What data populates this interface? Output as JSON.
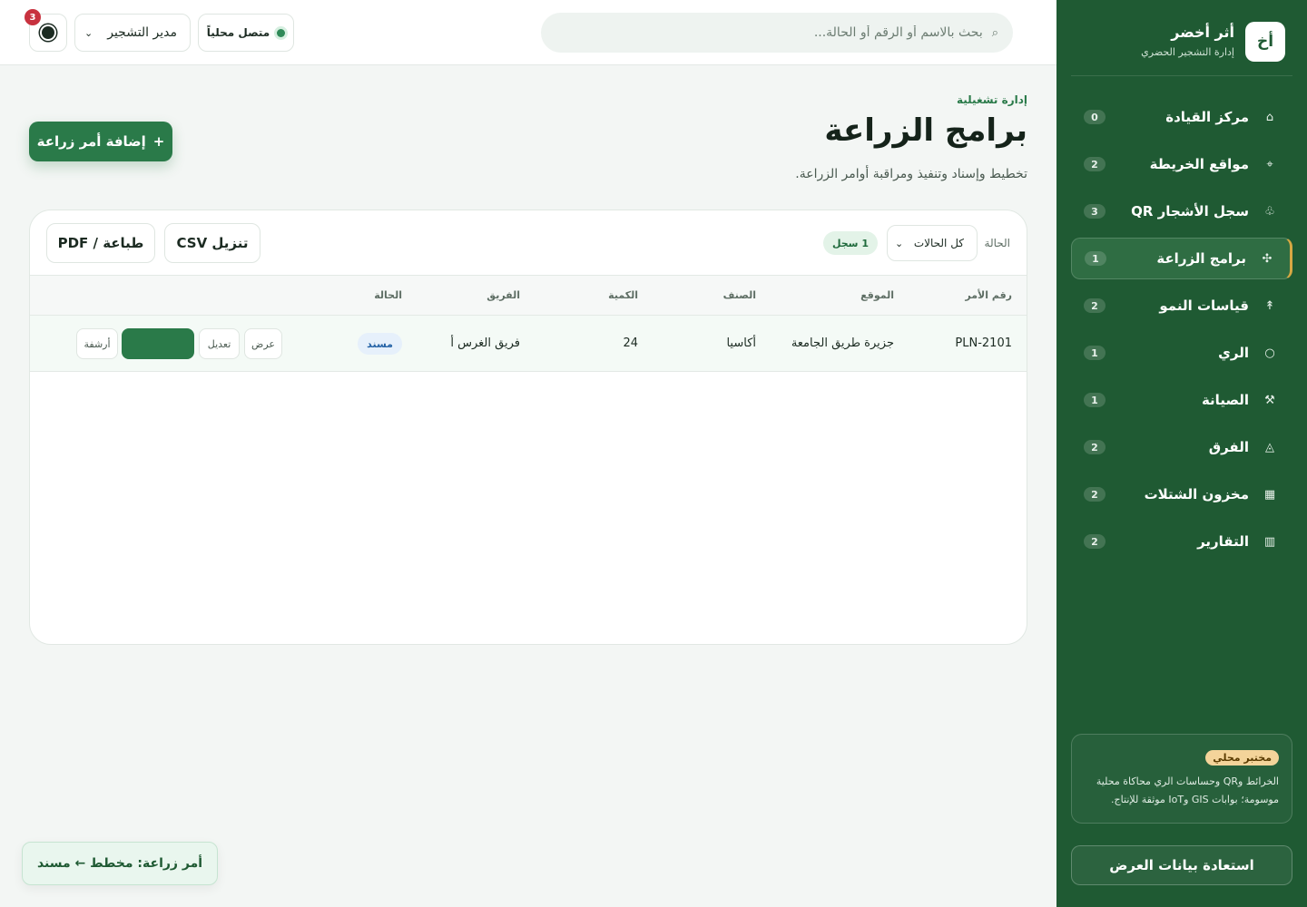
{
  "brand": {
    "logo": "أخ",
    "name": "أثر أخضر",
    "subtitle": "إدارة التشجير الحضري"
  },
  "sidebar": {
    "items": [
      {
        "icon": "⌂",
        "icon_name": "home-icon",
        "label": "مركز القيادة",
        "count": "0"
      },
      {
        "icon": "⌖",
        "icon_name": "map-pin-icon",
        "label": "مواقع الخريطة",
        "count": "2"
      },
      {
        "icon": "♧",
        "icon_name": "tree-icon",
        "label": "سجل الأشجار QR",
        "count": "3"
      },
      {
        "icon": "✣",
        "icon_name": "planting-icon",
        "label": "برامج الزراعة",
        "count": "1"
      },
      {
        "icon": "↟",
        "icon_name": "growth-icon",
        "label": "قياسات النمو",
        "count": "2"
      },
      {
        "icon": "○",
        "icon_name": "water-drop-icon",
        "label": "الري",
        "count": "1"
      },
      {
        "icon": "⚒",
        "icon_name": "tools-icon",
        "label": "الصيانة",
        "count": "1"
      },
      {
        "icon": "◬",
        "icon_name": "team-icon",
        "label": "الفرق",
        "count": "2"
      },
      {
        "icon": "▦",
        "icon_name": "inventory-icon",
        "label": "مخزون الشتلات",
        "count": "2"
      },
      {
        "icon": "▥",
        "icon_name": "reports-icon",
        "label": "التقارير",
        "count": "2"
      }
    ],
    "active_index": 3,
    "lab_card": {
      "tag": "مختبر محلي",
      "text": "الخرائط وQR وحساسات الري محاكاة محلية موسومة؛ بوابات GIS وIoT موثقة للإنتاج."
    },
    "restore_label": "استعادة بيانات العرض"
  },
  "topbar": {
    "search_placeholder": "بحث بالاسم أو الرقم أو الحالة...",
    "status_label": "متصل محلياً",
    "role_value": "مدير التشجير",
    "notifications_count": "3"
  },
  "page": {
    "eyebrow": "إدارة تشغيلية",
    "title": "برامج الزراعة",
    "subtitle": "تخطيط وإسناد وتنفيذ ومراقبة أوامر الزراعة.",
    "add_button": "إضافة أمر زراعة",
    "add_button_icon": "+"
  },
  "toolbar": {
    "filter_label": "الحالة",
    "filter_value": "كل الحالات",
    "record_count": "1 سجل",
    "csv_label": "تنزيل CSV",
    "pdf_label": "طباعة / PDF"
  },
  "table": {
    "headers": [
      "رقم الأمر",
      "الموقع",
      "الصنف",
      "الكمية",
      "الفريق",
      "الحالة"
    ],
    "rows": [
      {
        "order_id": "PLN-2101",
        "location": "جزيرة طريق الجامعة",
        "species": "أكاسيا",
        "quantity": "24",
        "team": "فريق الغرس أ",
        "status": "مسند",
        "actions": {
          "view": "عرض",
          "edit": "تعديل",
          "archive": "أرشفة"
        }
      }
    ]
  },
  "toast": {
    "text": "أمر زراعة: مخطط ← مسند"
  },
  "colors": {
    "sidebar_bg": "#1f5a33",
    "accent": "#2a7a49",
    "active_marker": "#d6a843",
    "status_blue": "#2563a6",
    "alert_red": "#c8323f"
  }
}
